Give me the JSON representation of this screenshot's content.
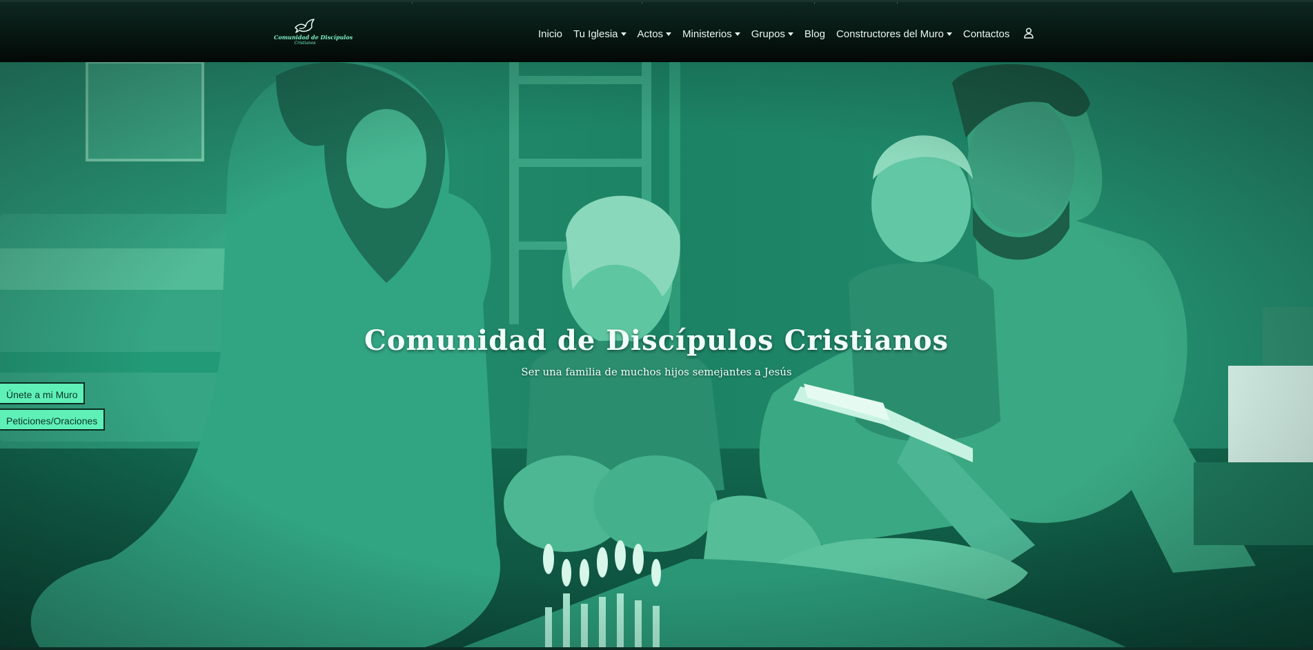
{
  "header": {
    "brand": {
      "name": "Comunidad de Discípulos",
      "sub": "Cristianos",
      "logo_icon": "dove-icon"
    },
    "nav": [
      {
        "label": "Inicio",
        "dropdown": false
      },
      {
        "label": "Tu Iglesia",
        "dropdown": true
      },
      {
        "label": "Actos",
        "dropdown": true
      },
      {
        "label": "Ministerios",
        "dropdown": true
      },
      {
        "label": "Grupos",
        "dropdown": true
      },
      {
        "label": "Blog",
        "dropdown": false
      },
      {
        "label": "Constructores del Muro",
        "dropdown": true
      },
      {
        "label": "Contactos",
        "dropdown": false
      }
    ],
    "user_icon": "user-icon"
  },
  "hero": {
    "title": "Comunidad de Discípulos Cristianos",
    "subtitle": "Ser una familia de muchos hijos semejantes a Jesús",
    "side_buttons": {
      "muro": "Únete a mi Muro",
      "peticiones": "Peticiones/Oraciones"
    },
    "overlay_color": "#1d8a6a"
  },
  "colors": {
    "accent": "#5ff0b8",
    "nav_text": "#e7f8f1",
    "header_bg": "#071712"
  }
}
